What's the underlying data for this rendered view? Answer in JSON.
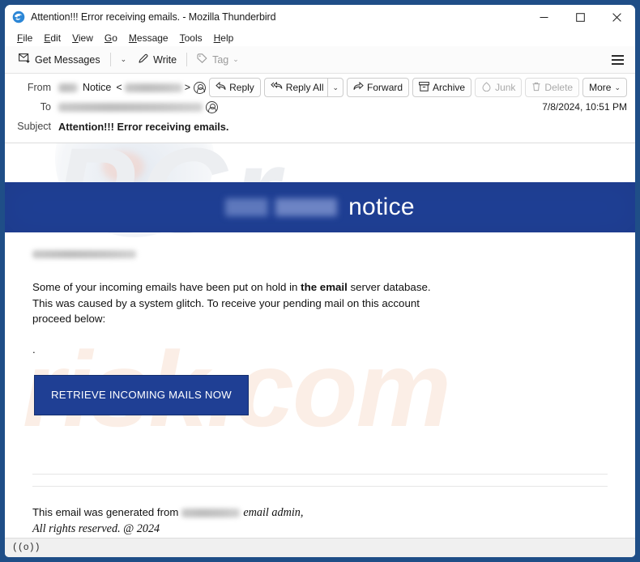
{
  "window": {
    "title": "Attention!!! Error receiving emails. - Mozilla Thunderbird",
    "app_icon": "thunderbird-icon",
    "controls": {
      "minimize": "–",
      "maximize": "☐",
      "close": "✕"
    }
  },
  "menubar": {
    "items": [
      {
        "accel": "F",
        "rest": "ile"
      },
      {
        "accel": "E",
        "rest": "dit"
      },
      {
        "accel": "V",
        "rest": "iew"
      },
      {
        "accel": "G",
        "rest": "o"
      },
      {
        "accel": "M",
        "rest": "essage"
      },
      {
        "accel": "T",
        "rest": "ools"
      },
      {
        "accel": "H",
        "rest": "elp"
      }
    ]
  },
  "toolbar": {
    "get_messages": "Get Messages",
    "get_messages_chevron": "⌄",
    "write": "Write",
    "tag": "Tag",
    "tag_chevron": "⌄",
    "app_menu": "hamburger-menu"
  },
  "message_header": {
    "from_label": "From",
    "from_display_name": "Notice",
    "from_bracket_open": "<",
    "from_bracket_close": ">",
    "to_label": "To",
    "subject_label": "Subject",
    "subject_value": "Attention!!! Error receiving emails.",
    "date": "7/8/2024, 10:51 PM",
    "actions": {
      "reply": "Reply",
      "reply_all": "Reply All",
      "reply_all_chevron": "⌄",
      "forward": "Forward",
      "archive": "Archive",
      "junk": "Junk",
      "delete": "Delete",
      "more": "More",
      "more_chevron": "⌄"
    }
  },
  "email": {
    "banner_title": "notice",
    "banner_color": "#1f3f94",
    "body_lines": [
      "Some of your incoming emails have been put on hold in ",
      "the email",
      " server database.",
      "This was caused by a system glitch. To receive your pending mail on this account",
      "proceed below:"
    ],
    "line1_a": "Some of your incoming emails have been put on hold in ",
    "line1_bold": "the email",
    "line1_b": " server database.",
    "line2": "This was caused by a system glitch. To receive your pending mail on this account",
    "line3": "proceed below:",
    "dot": ".",
    "cta_label": "RETRIEVE INCOMING MAILS NOW",
    "cta_color": "#1f3f94",
    "footer_prefix": "This email was generated from",
    "footer_suffix": "email admin,",
    "footer_rights": "All rights reserved. @ 2024"
  },
  "watermark": {
    "top": "PCr",
    "bottom": "risk.com"
  },
  "statusbar": {
    "indicator": "((o))"
  }
}
